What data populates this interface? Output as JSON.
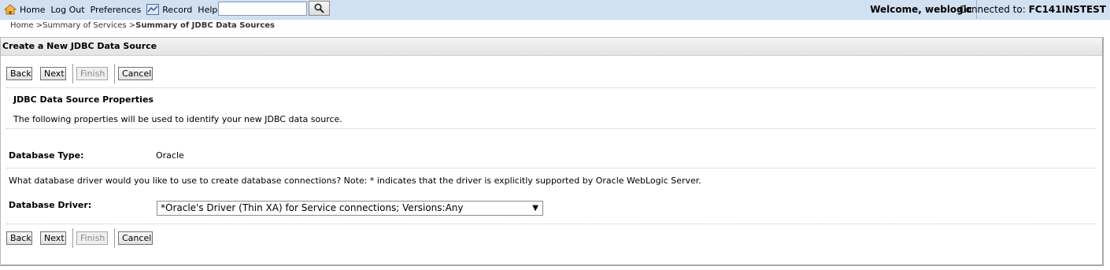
{
  "topbar": {
    "home_label": "Home",
    "logout_label": "Log Out",
    "preferences_label": "Preferences",
    "record_label": "Record",
    "help_label": "Help",
    "search_value": "",
    "welcome_text": "Welcome, weblogic",
    "connected_prefix": "Connected to:",
    "connected_server": "FC141INSTEST"
  },
  "breadcrumb": {
    "home": "Home >",
    "services": "Summary of Services >",
    "current": "Summary of JDBC Data Sources"
  },
  "panel": {
    "title": "Create a New JDBC Data Source",
    "buttons": {
      "back": "Back",
      "next": "Next",
      "finish": "Finish",
      "cancel": "Cancel"
    },
    "section_title": "JDBC Data Source Properties",
    "section_desc": "The following properties will be used to identify your new JDBC data source.",
    "database_type_label": "Database Type:",
    "database_type_value": "Oracle",
    "driver_question": "What database driver would you like to use to create database connections? Note: * indicates that the driver is explicitly supported by Oracle WebLogic Server.",
    "database_driver_label": "Database Driver:",
    "database_driver_value": "*Oracle's Driver (Thin XA) for Service connections; Versions:Any"
  }
}
